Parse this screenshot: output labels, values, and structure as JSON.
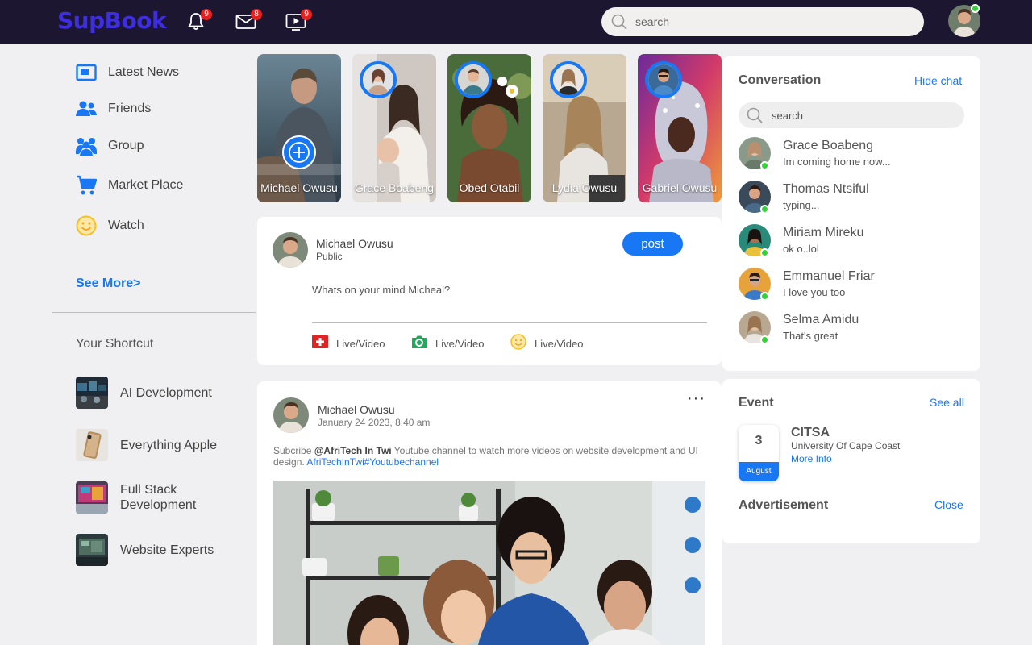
{
  "app": {
    "logo": "SupBook"
  },
  "header": {
    "notifications_count": "9",
    "messages_count": "8",
    "videos_count": "9",
    "search_placeholder": "search"
  },
  "sidebar": {
    "items": [
      {
        "label": "Latest News",
        "icon": "news-icon"
      },
      {
        "label": "Friends",
        "icon": "friends-icon"
      },
      {
        "label": "Group",
        "icon": "group-icon"
      },
      {
        "label": "Market Place",
        "icon": "cart-icon"
      },
      {
        "label": "Watch",
        "icon": "smiley-icon"
      }
    ],
    "see_more": "See More>",
    "shortcut_title": "Your Shortcut",
    "shortcuts": [
      {
        "label": "AI Development"
      },
      {
        "label": "Everything Apple"
      },
      {
        "label": "Full Stack Development"
      },
      {
        "label": "Website Experts"
      }
    ]
  },
  "stories": [
    {
      "name": "Michael Owusu"
    },
    {
      "name": "Grace Boabeng"
    },
    {
      "name": "Obed Otabil"
    },
    {
      "name": "Lydia Owusu"
    },
    {
      "name": "Gabriel Owusu"
    }
  ],
  "create_post": {
    "user_name": "Michael Owusu",
    "visibility": "Public",
    "post_button": "post",
    "placeholder": "Whats on your mind Micheal?",
    "actions": [
      {
        "label": "Live/Video",
        "icon": "video-camera-icon",
        "color": "#e02424"
      },
      {
        "label": "Live/Video",
        "icon": "photo-camera-icon",
        "color": "#22a95c"
      },
      {
        "label": "Live/Video",
        "icon": "smiley-icon",
        "color": "#f2c124"
      }
    ]
  },
  "feed_post": {
    "user_name": "Michael Owusu",
    "date": "January 24 2023, 8:40 am",
    "text_prefix": "Subcribe ",
    "text_handle": "@AfriTech In Twi",
    "text_body": " Youtube channel to watch more videos on website development and UI design. ",
    "text_link": "AfriTechInTwi#Youtubechannel",
    "menu": "···"
  },
  "conversation": {
    "title": "Conversation",
    "hide_chat": "Hide chat",
    "search_placeholder": "search",
    "chats": [
      {
        "name": "Grace Boabeng",
        "message": "Im coming home now..."
      },
      {
        "name": "Thomas Ntsiful",
        "message": "typing..."
      },
      {
        "name": "Miriam Mireku",
        "message": "ok o..lol"
      },
      {
        "name": "Emmanuel Friar",
        "message": "I love you too"
      },
      {
        "name": "Selma Amidu",
        "message": "That's great"
      }
    ]
  },
  "event": {
    "title": "Event",
    "see_all": "See all",
    "day": "3",
    "month": "August",
    "name": "CITSA",
    "location": "University Of Cape Coast",
    "more_info": "More Info"
  },
  "advertisement": {
    "title": "Advertisement",
    "close": "Close"
  },
  "colors": {
    "brand": "#3d2ee0",
    "accent": "#1877f2",
    "topbar": "#1c1630",
    "online": "#36d138",
    "badge": "#e52222"
  }
}
